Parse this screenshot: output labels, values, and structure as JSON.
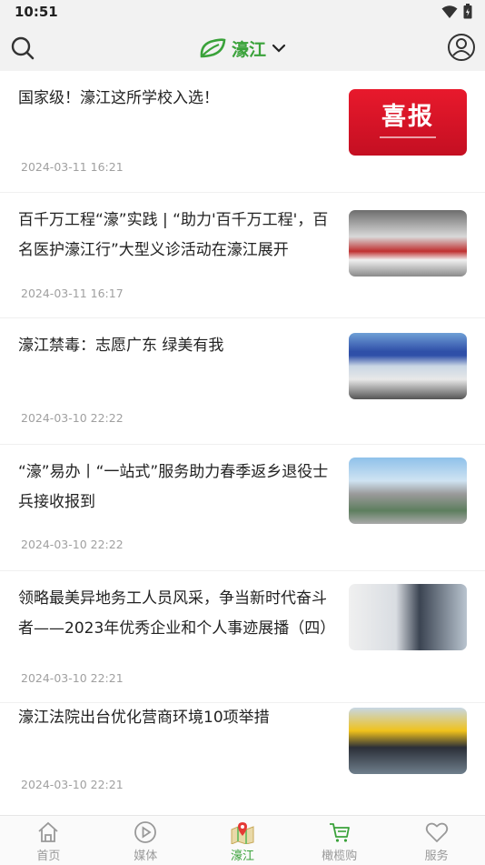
{
  "status": {
    "time": "10:51"
  },
  "header": {
    "title": "濠江"
  },
  "colors": {
    "accent": "#3aa23a",
    "muted": "#999999",
    "date": "#a0a0a0"
  },
  "articles": [
    {
      "title": "国家级！濠江这所学校入选！",
      "date": "2024-03-11 16:21",
      "thumb_text": "喜报",
      "thumb_icon": "red-announcement-image"
    },
    {
      "title": "百千万工程“濠”实践 | “助力'百千万工程'，百名医护濠江行”大型义诊活动在濠江展开",
      "date": "2024-03-11 16:17",
      "thumb_icon": "crowd-photo"
    },
    {
      "title": "濠江禁毒：志愿广东 绿美有我",
      "date": "2024-03-10 22:22",
      "thumb_icon": "tent-event-photo"
    },
    {
      "title": "“濠”易办丨“一站式”服务助力春季返乡退役士兵接收报到",
      "date": "2024-03-10 22:22",
      "thumb_icon": "building-photo"
    },
    {
      "title": "领略最美异地务工人员风采，争当新时代奋斗者——2023年优秀企业和个人事迹展播（四）",
      "date": "2024-03-10 22:21",
      "thumb_icon": "lab-worker-photo"
    },
    {
      "title": "濠江法院出台优化营商环境10项举措",
      "date": "2024-03-10 22:21",
      "thumb_icon": "factory-visit-photo"
    }
  ],
  "nav": [
    {
      "label": "首页",
      "icon": "home-icon"
    },
    {
      "label": "媒体",
      "icon": "play-icon"
    },
    {
      "label": "濠江",
      "icon": "map-pin-icon",
      "active": true
    },
    {
      "label": "橄榄购",
      "icon": "cart-icon"
    },
    {
      "label": "服务",
      "icon": "heart-icon"
    }
  ]
}
